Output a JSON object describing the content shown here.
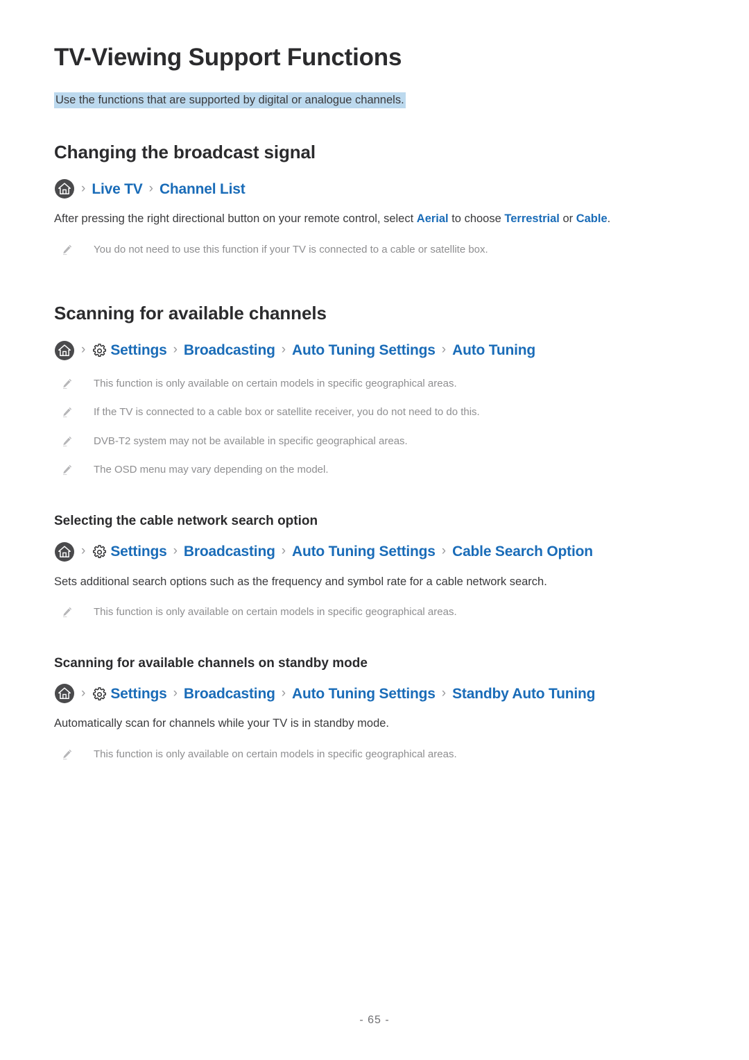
{
  "document": {
    "title": "TV-Viewing Support Functions",
    "lead": "Use the functions that are supported by digital or analogue channels.",
    "lead_highlight_color": "#bcd9ee",
    "link_color": "#1a6cb8",
    "note_text_color": "#8e8e90",
    "page_number": "- 65 -"
  },
  "sections": [
    {
      "heading": "Changing the broadcast signal",
      "path": {
        "home_icon": "home-icon",
        "separator": "›",
        "crumbs": [
          "Live TV",
          "Channel List"
        ]
      },
      "paragraph": {
        "part1": "After pressing the right directional button on your remote control, select ",
        "link1": "Aerial",
        "part2": " to choose ",
        "link2": "Terrestrial",
        "part3": " or ",
        "link3": "Cable",
        "part4": "."
      },
      "notes": [
        "You do not need to use this function if your TV is connected to a cable or satellite box."
      ]
    },
    {
      "heading": "Scanning for available channels",
      "path": {
        "home_icon": "home-icon",
        "gear_icon": "gear-icon",
        "separator": "›",
        "crumbs": [
          "Settings",
          "Broadcasting",
          "Auto Tuning Settings",
          "Auto Tuning"
        ]
      },
      "notes": [
        "This function is only available on certain models in specific geographical areas.",
        "If the TV is connected to a cable box or satellite receiver, you do not need to do this.",
        "DVB-T2 system may not be available in specific geographical areas.",
        "The OSD menu may vary depending on the model."
      ]
    }
  ],
  "subsections": [
    {
      "heading": "Selecting the cable network search option",
      "path": {
        "home_icon": "home-icon",
        "gear_icon": "gear-icon",
        "separator": "›",
        "crumbs": [
          "Settings",
          "Broadcasting",
          "Auto Tuning Settings",
          "Cable Search Option"
        ]
      },
      "paragraph": "Sets additional search options such as the frequency and symbol rate for a cable network search.",
      "notes": [
        "This function is only available on certain models in specific geographical areas."
      ]
    },
    {
      "heading": "Scanning for available channels on standby mode",
      "path": {
        "home_icon": "home-icon",
        "gear_icon": "gear-icon",
        "separator": "›",
        "crumbs": [
          "Settings",
          "Broadcasting",
          "Auto Tuning Settings",
          "Standby Auto Tuning"
        ]
      },
      "paragraph": "Automatically scan for channels while your TV is in standby mode.",
      "notes": [
        "This function is only available on certain models in specific geographical areas."
      ]
    }
  ]
}
